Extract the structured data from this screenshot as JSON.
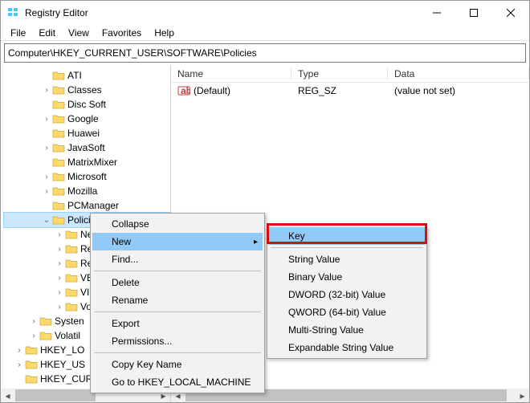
{
  "window": {
    "title": "Registry Editor"
  },
  "menus": {
    "file": "File",
    "edit": "Edit",
    "view": "View",
    "favorites": "Favorites",
    "help": "Help"
  },
  "address": {
    "path": "Computer\\HKEY_CURRENT_USER\\SOFTWARE\\Policies"
  },
  "tree": {
    "items": [
      "ATI",
      "Classes",
      "Disc Soft",
      "Google",
      "Huawei",
      "JavaSoft",
      "MatrixMixer",
      "Microsoft",
      "Mozilla",
      "PCManager",
      "Policies"
    ],
    "under_policies_partial": [
      "Ne",
      "Rea",
      "Reg",
      "VB",
      "VIS",
      "Vol"
    ],
    "after": [
      "Systen",
      "Volatil"
    ],
    "top2": [
      "HKEY_LO",
      "HKEY_US"
    ],
    "bottom": "HKEY_CURRENT_CONFIG"
  },
  "list": {
    "cols": {
      "name": "Name",
      "type": "Type",
      "data": "Data"
    },
    "rows": [
      {
        "name": "(Default)",
        "type": "REG_SZ",
        "data": "(value not set)"
      }
    ]
  },
  "ctx1": {
    "collapse": "Collapse",
    "new": "New",
    "find": "Find...",
    "delete": "Delete",
    "rename": "Rename",
    "export": "Export",
    "permissions": "Permissions...",
    "copykey": "Copy Key Name",
    "goto": "Go to HKEY_LOCAL_MACHINE"
  },
  "ctx2": {
    "key": "Key",
    "string": "String Value",
    "binary": "Binary Value",
    "dword": "DWORD (32-bit) Value",
    "qword": "QWORD (64-bit) Value",
    "multi": "Multi-String Value",
    "expand": "Expandable String Value"
  }
}
